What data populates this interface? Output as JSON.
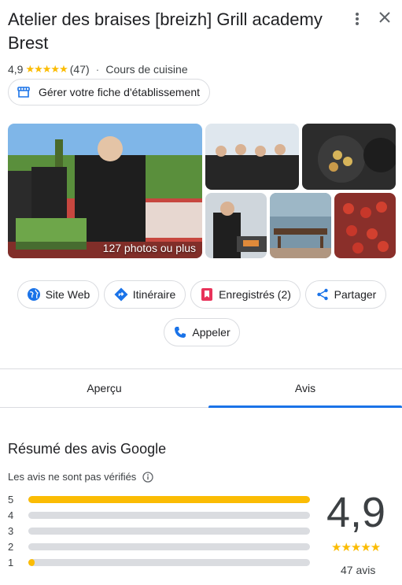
{
  "place": {
    "title": "Atelier des braises [breizh] Grill academy Brest",
    "rating": "4,9",
    "stars": "★★★★★",
    "review_count_paren": "(47)",
    "category": "Cours de cuisine"
  },
  "manage": {
    "label": "Gérer votre fiche d'établissement"
  },
  "photos": {
    "count_label": "127 photos ou plus"
  },
  "actions": [
    {
      "label": "Site Web",
      "icon": "globe-icon"
    },
    {
      "label": "Itinéraire",
      "icon": "directions-icon"
    },
    {
      "label": "Enregistrés (2)",
      "icon": "bookmark-icon"
    },
    {
      "label": "Partager",
      "icon": "share-icon"
    },
    {
      "label": "Appeler",
      "icon": "phone-icon"
    }
  ],
  "tabs": [
    {
      "label": "Aperçu",
      "active": false
    },
    {
      "label": "Avis",
      "active": true
    }
  ],
  "reviews": {
    "section_title": "Résumé des avis Google",
    "unverified_note": "Les avis ne sont pas vérifiés",
    "distribution": [
      {
        "star": "5",
        "fraction": 1.0
      },
      {
        "star": "4",
        "fraction": 0.0
      },
      {
        "star": "3",
        "fraction": 0.0
      },
      {
        "star": "2",
        "fraction": 0.0
      },
      {
        "star": "1",
        "fraction": 0.02
      }
    ],
    "average": "4,9",
    "stars": "★★★★★",
    "total_label": "47 avis"
  },
  "colors": {
    "accent": "#1a73e8",
    "star": "#fbbc04",
    "bookmark": "#e8335a"
  }
}
